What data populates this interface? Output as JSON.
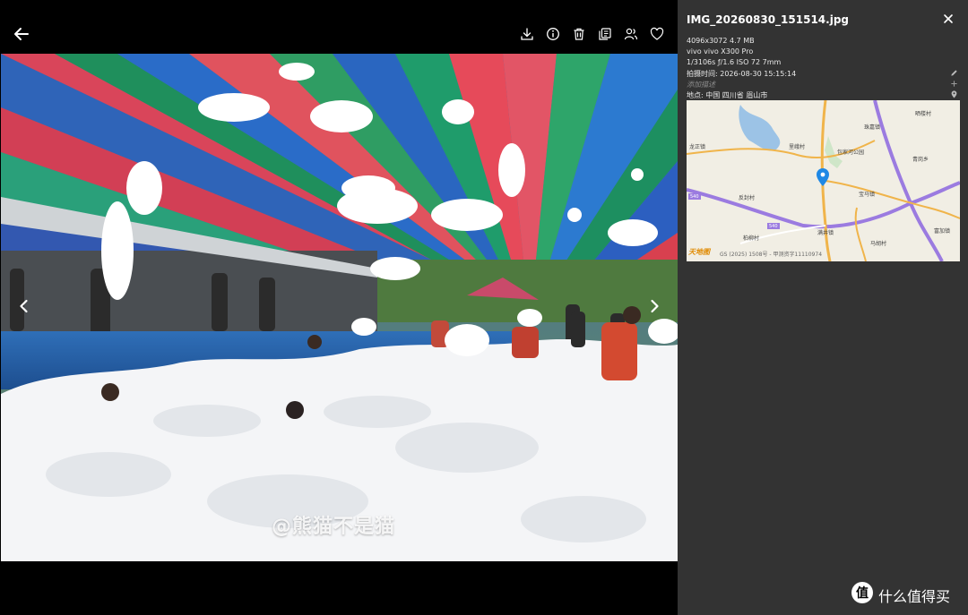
{
  "viewer": {
    "toolbar": {
      "icons": [
        "back-arrow-icon",
        "download-icon",
        "info-icon",
        "trash-icon",
        "copy-icon",
        "people-icon",
        "heart-icon"
      ]
    },
    "watermark": "@熊猫不是猫"
  },
  "info_panel": {
    "filename": "IMG_20260830_151514.jpg",
    "resolution_size": "4096x3072  4.7 MB",
    "device": "vivo  vivo X300 Pro",
    "exposure": "1/3106s  ƒ/1.6  ISO 72  7mm",
    "capture_time": "拍摄时间: 2026-08-30 15:15:14",
    "description_placeholder": "添加描述",
    "location": "地点: 中国 四川省 眉山市",
    "map": {
      "labels": [
        "晒楼村",
        "珠嘉镇",
        "龙正镇",
        "里峨村",
        "包家河公园",
        "青岗乡",
        "反封村",
        "宝马镇",
        "柏柳村",
        "满井镇",
        "马胡村",
        "富加镇"
      ],
      "road_numbers": [
        "540",
        "540"
      ],
      "logo": "天地图",
      "copyright": "GS (2025) 1508号 - 甲测资字11110974"
    }
  },
  "brand": {
    "text": "什么值得买"
  }
}
